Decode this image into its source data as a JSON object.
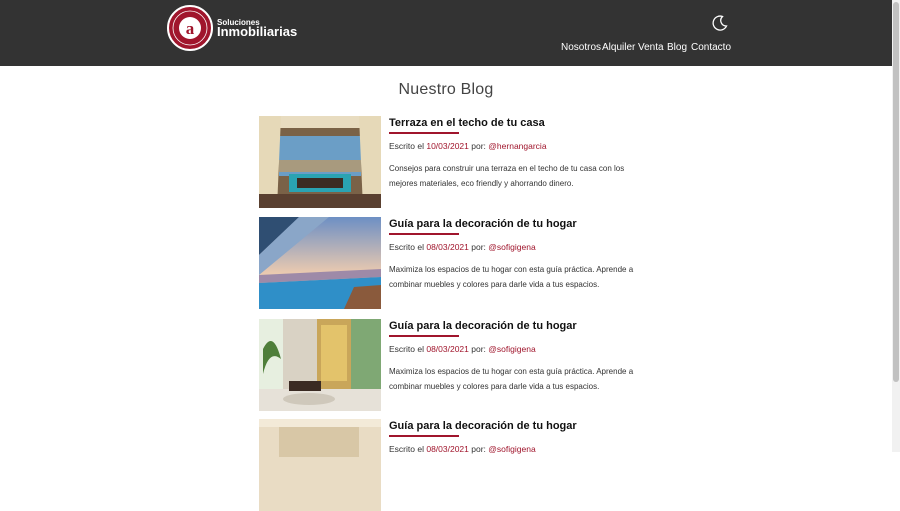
{
  "brand": {
    "small": "Soluciones",
    "big": "Inmobiliarias",
    "seal_text": "SOLUCIONES INMOBILIARIAS"
  },
  "theme_icon": "moon-icon",
  "nav": [
    "Nosotros",
    "Alquiler",
    "Venta",
    "Blog",
    "Contacto"
  ],
  "page_title": "Nuestro Blog",
  "colors": {
    "header_bg": "#333333",
    "accent": "#a0152c"
  },
  "posts": [
    {
      "title": "Terraza en el techo de tu casa",
      "written_prefix": "Escrito el",
      "date": "10/03/2021",
      "by_prefix": "por:",
      "author": "@hernangarcia",
      "excerpt": "Consejos para construir una terraza en el techo de tu casa con los mejores materiales, eco friendly y ahorrando dinero.",
      "image": "rooftop-terrace"
    },
    {
      "title": "Guía para la decoración de tu hogar",
      "written_prefix": "Escrito el",
      "date": "08/03/2021",
      "by_prefix": "por:",
      "author": "@sofigigena",
      "excerpt": "Maximiza los espacios de tu hogar con esta guía práctica. Aprende a combinar muebles y colores para darle vida a tus espacios.",
      "image": "infinity-pool"
    },
    {
      "title": "Guía para la decoración de tu hogar",
      "written_prefix": "Escrito el",
      "date": "08/03/2021",
      "by_prefix": "por:",
      "author": "@sofigigena",
      "excerpt": "Maximiza los espacios de tu hogar con esta guía práctica. Aprende a combinar muebles y colores para darle vida a tus espacios.",
      "image": "living-room"
    },
    {
      "title": "Guía para la decoración de tu hogar",
      "written_prefix": "Escrito el",
      "date": "08/03/2021",
      "by_prefix": "por:",
      "author": "@sofigigena",
      "excerpt": "",
      "image": "interior"
    }
  ]
}
